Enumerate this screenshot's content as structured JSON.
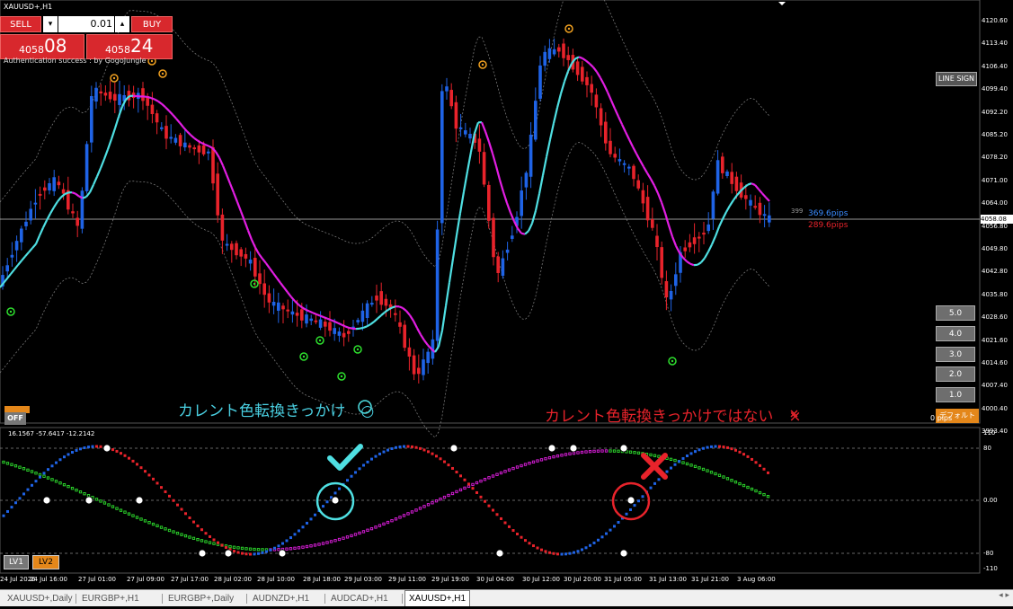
{
  "window": {
    "title": "XAUUSD+,H1"
  },
  "trade_panel": {
    "sell_label": "SELL",
    "buy_label": "BUY",
    "lot_dec": "▾",
    "lot_inc": "▴",
    "lot_value": "0.01",
    "bid_small": "4058",
    "bid_big": "08",
    "ask_small": "4058",
    "ask_big": "24"
  },
  "auth_text": "Authentication success : by GogoJungle",
  "buttons": {
    "line_sign": "LINE SIGN",
    "levels": [
      "5.0",
      "4.0",
      "3.0",
      "2.0",
      "1.0"
    ],
    "off": "OFF",
    "reset": "デフォルト",
    "lv1": "LV1",
    "lv2": "LV2"
  },
  "pip_zero": "0 pips",
  "pips": {
    "count": "399",
    "blue": "369.6pips",
    "red": "289.6pips"
  },
  "annotations": {
    "cyan_text": "カレント色転換きっかけ　○",
    "red_text": "カレント色転換きっかけではない　×"
  },
  "price_axis": [
    "4120.60",
    "4113.40",
    "4106.40",
    "4099.40",
    "4092.20",
    "4085.20",
    "4078.20",
    "4071.00",
    "4064.00",
    "4056.80",
    "4049.80",
    "4042.80",
    "4035.80",
    "4028.60",
    "4021.60",
    "4014.60",
    "4007.40",
    "4000.40",
    "3993.40"
  ],
  "current_price": "4058.08",
  "oscillator": {
    "label": "16.1567 -57.6417 -12.2142",
    "scale": [
      "110",
      "80",
      "0.00",
      "-80",
      "-110"
    ]
  },
  "time_axis": [
    "24 Jul 2026",
    "24 Jul 16:00",
    "27 Jul 01:00",
    "27 Jul 09:00",
    "27 Jul 17:00",
    "28 Jul 02:00",
    "28 Jul 10:00",
    "28 Jul 18:00",
    "29 Jul 03:00",
    "29 Jul 11:00",
    "29 Jul 19:00",
    "30 Jul 04:00",
    "30 Jul 12:00",
    "30 Jul 20:00",
    "31 Jul 05:00",
    "31 Jul 13:00",
    "31 Jul 21:00",
    "3 Aug 06:00"
  ],
  "tabs": [
    "XAUUSD+,Daily",
    "EURGBP+,H1",
    "EURGBP+,Daily",
    "AUDNZD+,H1",
    "AUDCAD+,H1",
    "XAUUSD+,H1"
  ],
  "active_tab": "XAUUSD+,H1",
  "colors": {
    "bull": "#1f63e6",
    "bear": "#e8232b",
    "ma_up": "#4fe0e3",
    "ma_down": "#e31ee3",
    "accent": "#d8282d",
    "orange": "#e4871a"
  }
}
